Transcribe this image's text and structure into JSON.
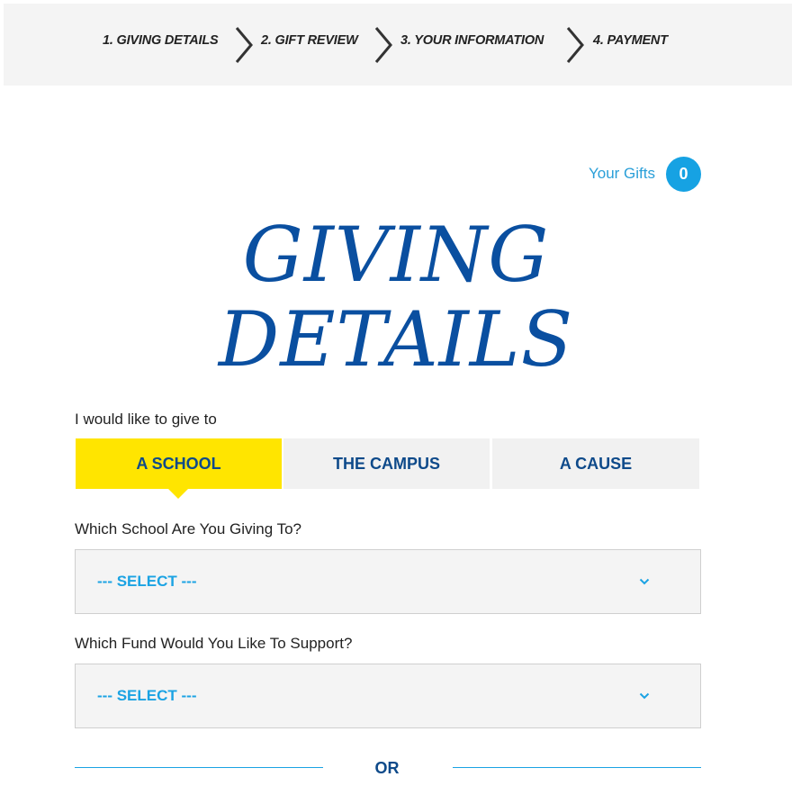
{
  "steps": [
    {
      "label": "1. GIVING DETAILS"
    },
    {
      "label": "2. GIFT REVIEW"
    },
    {
      "label": "3. YOUR INFORMATION"
    },
    {
      "label": "4. PAYMENT"
    }
  ],
  "gifts": {
    "label": "Your Gifts",
    "count": "0"
  },
  "title": {
    "line1": "GIVING",
    "line2": "DETAILS"
  },
  "give_to": {
    "label": "I would like to give to",
    "tabs": [
      "A SCHOOL",
      "THE CAMPUS",
      "A CAUSE"
    ],
    "active_tab": "A SCHOOL"
  },
  "school_select": {
    "label": "Which School Are You Giving To?",
    "value": "--- SELECT ---"
  },
  "fund_select": {
    "label": "Which Fund Would You Like To Support?",
    "value": "--- SELECT ---"
  },
  "divider": {
    "text": "OR"
  },
  "colors": {
    "accent_yellow": "#ffe500",
    "title_blue": "#0a4fa0",
    "link_blue": "#1ba3e3"
  }
}
